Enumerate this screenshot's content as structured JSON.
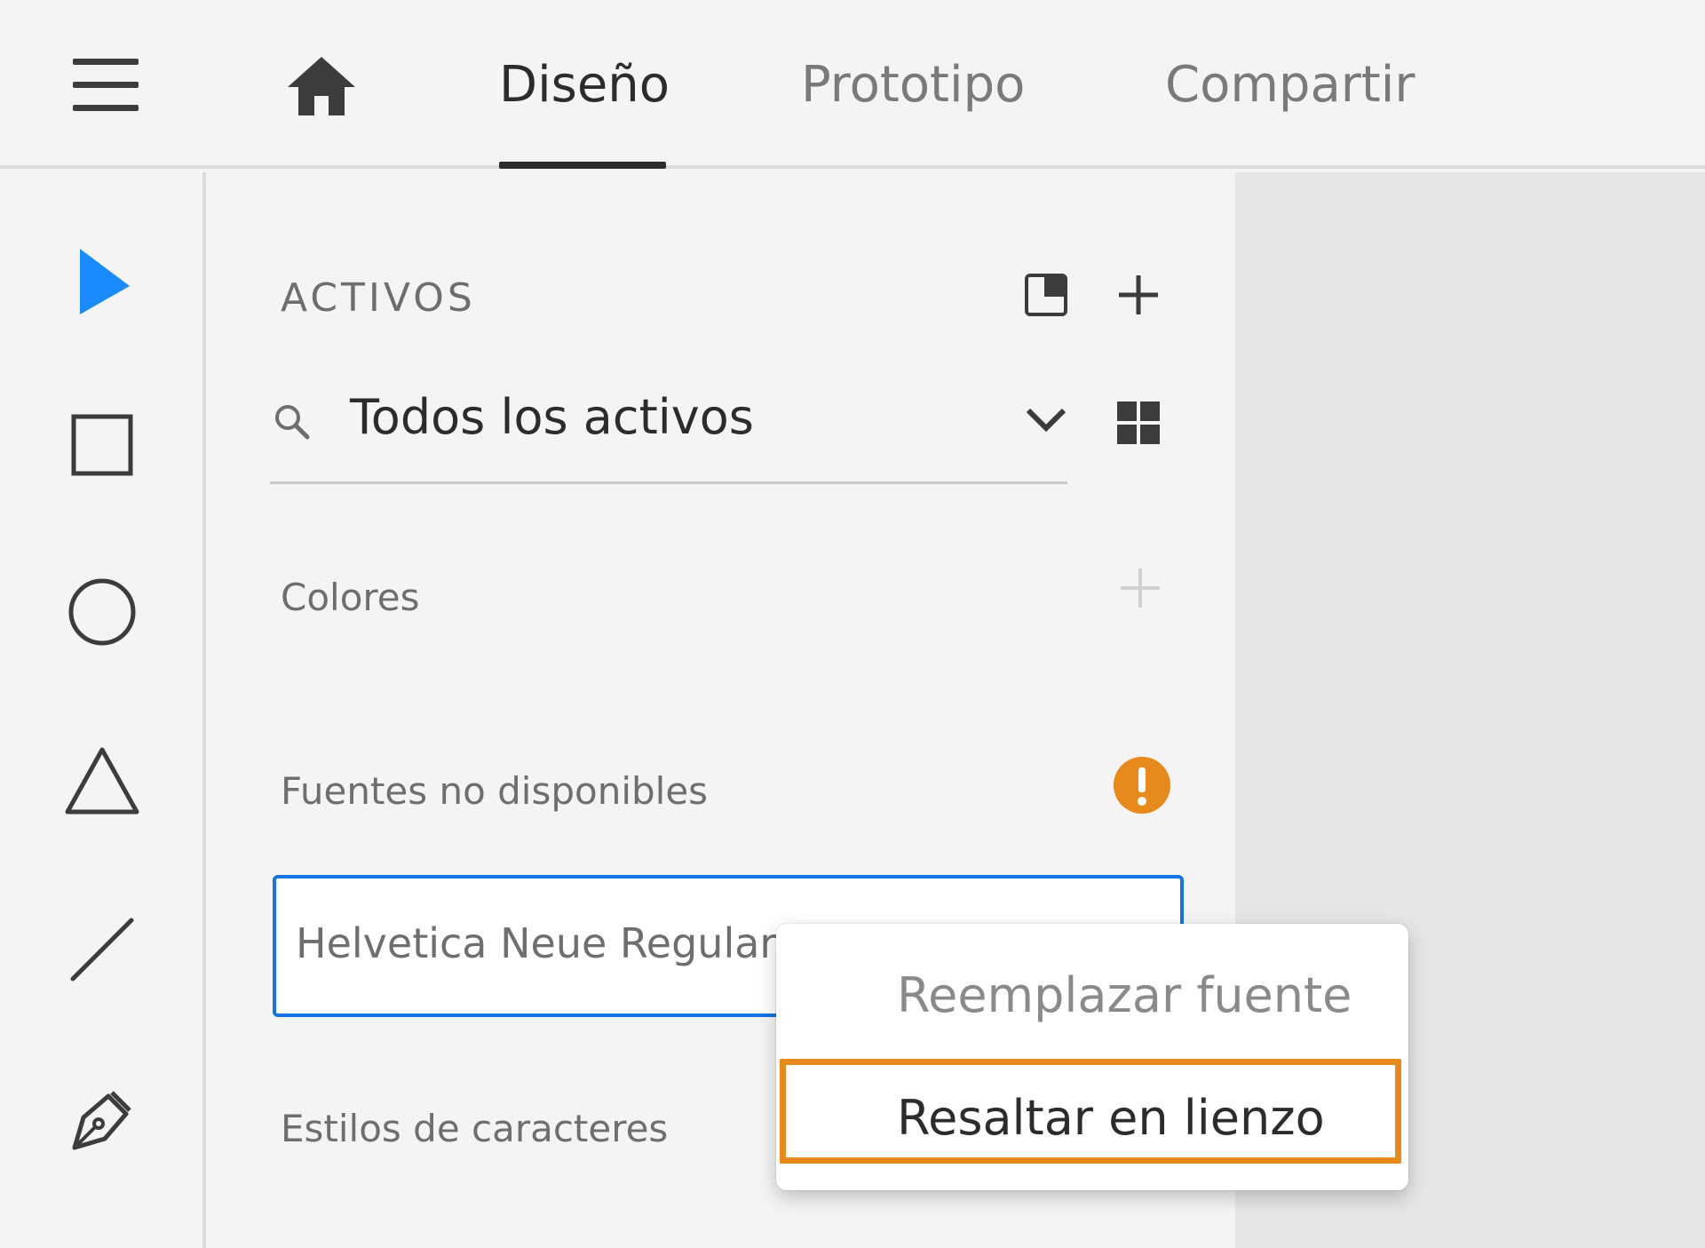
{
  "header": {
    "tabs": [
      {
        "label": "Diseño",
        "active": true
      },
      {
        "label": "Prototipo",
        "active": false
      },
      {
        "label": "Compartir",
        "active": false
      }
    ]
  },
  "tools": [
    "select-tool",
    "rectangle-tool",
    "ellipse-tool",
    "triangle-tool",
    "line-tool",
    "pen-tool"
  ],
  "assets": {
    "title": "ACTIVOS",
    "filter_value": "Todos los activos",
    "sections": {
      "colors": "Colores",
      "missing_fonts": "Fuentes no disponibles",
      "character_styles": "Estilos de caracteres"
    },
    "missing_font": "Helvetica Neue Regular"
  },
  "context_menu": {
    "items": [
      "Reemplazar fuente",
      "Resaltar en lienzo"
    ],
    "highlighted": "Resaltar en lienzo"
  },
  "colors": {
    "accent": "#1473e6",
    "warning": "#e8891b"
  }
}
